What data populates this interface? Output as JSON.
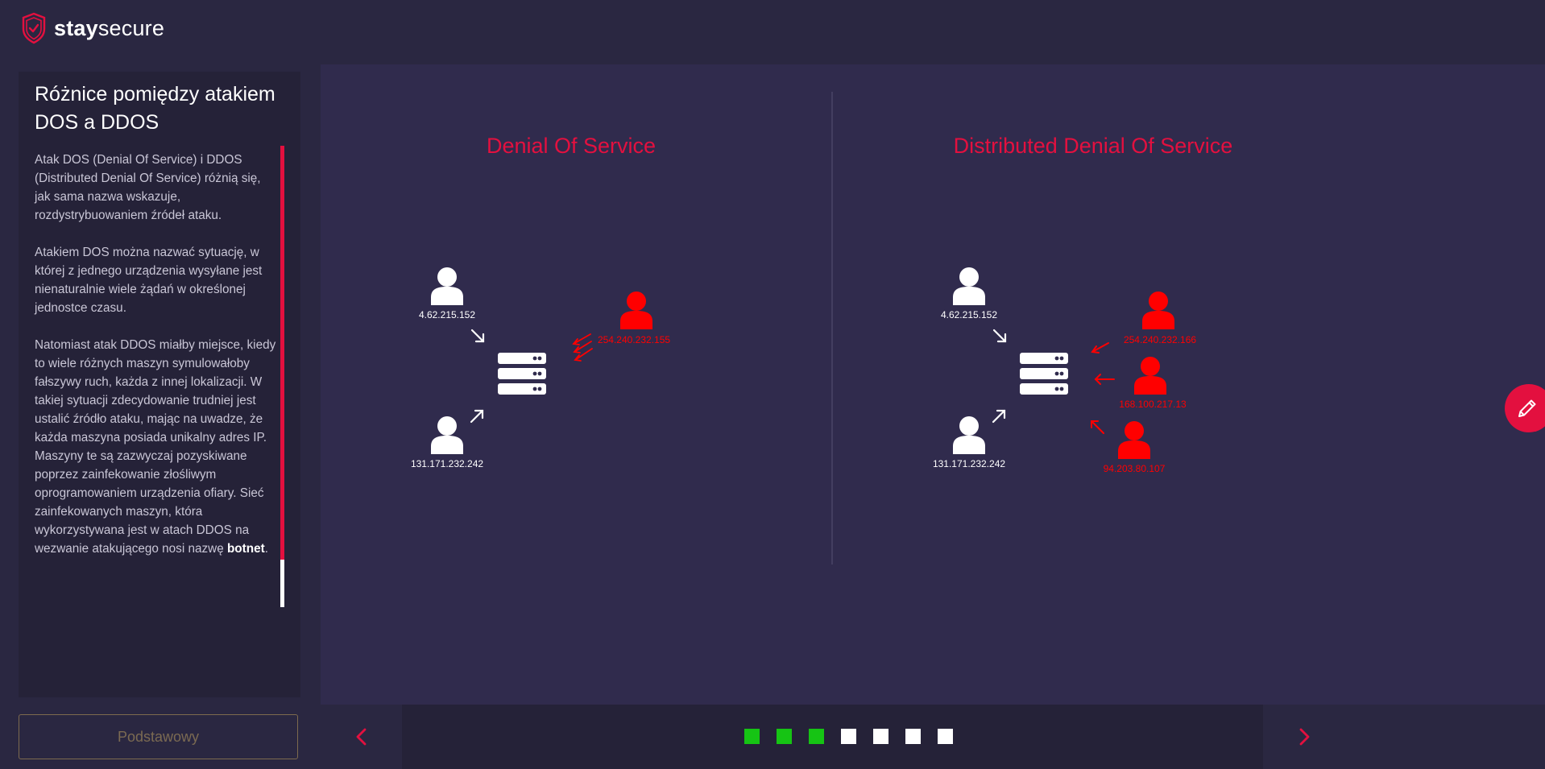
{
  "brand": {
    "name_bold": "stay",
    "name_light": "secure",
    "logo_icon": "shield-check-icon",
    "accent": "#e3103f"
  },
  "sidebar": {
    "title": "Różnice pomiędzy atakiem DOS a DDOS",
    "paragraphs": [
      "Atak DOS (Denial Of Service) i DDOS (Distributed Denial Of Service) różnią się, jak sama nazwa wskazuje, rozdystrybuowaniem źródeł ataku.",
      "Atakiem DOS można nazwać sytuację, w której z jednego urządzenia wysyłane jest nienaturalnie wiele żądań w określonej jednostce czasu."
    ],
    "paragraph3_text": "Natomiast atak DDOS miałby miejsce, kiedy to wiele różnych maszyn symulowałoby fałszywy ruch, każda z innej lokalizacji. W takiej sytuacji zdecydowanie trudniej jest ustalić źródło ataku, mając na uwadze, że każda maszyna posiada unikalny adres IP. Maszyny te są zazwyczaj pozyskiwane poprzez zainfekowanie złośliwym oprogramowaniem urządzenia ofiary. Sieć zainfekowanych maszyn, która wykorzystywana jest w atach DDOS na wezwanie atakującego nosi nazwę ",
    "paragraph3_bold": "botnet",
    "paragraph3_end": ".",
    "scroll_position": 0.9
  },
  "level_button_label": "Podstawowy",
  "dos": {
    "title": "Denial Of Service",
    "user_top_ip": "4.62.215.152",
    "user_bottom_ip": "131.171.232.242",
    "attacker_ip": "254.240.232.155"
  },
  "ddos": {
    "title": "Distributed Denial Of Service",
    "user_top_ip": "4.62.215.152",
    "user_bottom_ip": "131.171.232.242",
    "attacker_ips": [
      "254.240.232.166",
      "168.100.217.13",
      "94.203.80.107"
    ]
  },
  "colors": {
    "attacker": "#ff0000",
    "user": "#ffffff",
    "step_done": "#16c414",
    "step_todo": "#ffffff"
  },
  "navigation": {
    "prev_icon": "chevron-left-icon",
    "next_icon": "chevron-right-icon",
    "steps": [
      "done",
      "done",
      "done",
      "todo",
      "todo",
      "todo",
      "todo"
    ]
  },
  "edit_icon": "pencil-icon"
}
